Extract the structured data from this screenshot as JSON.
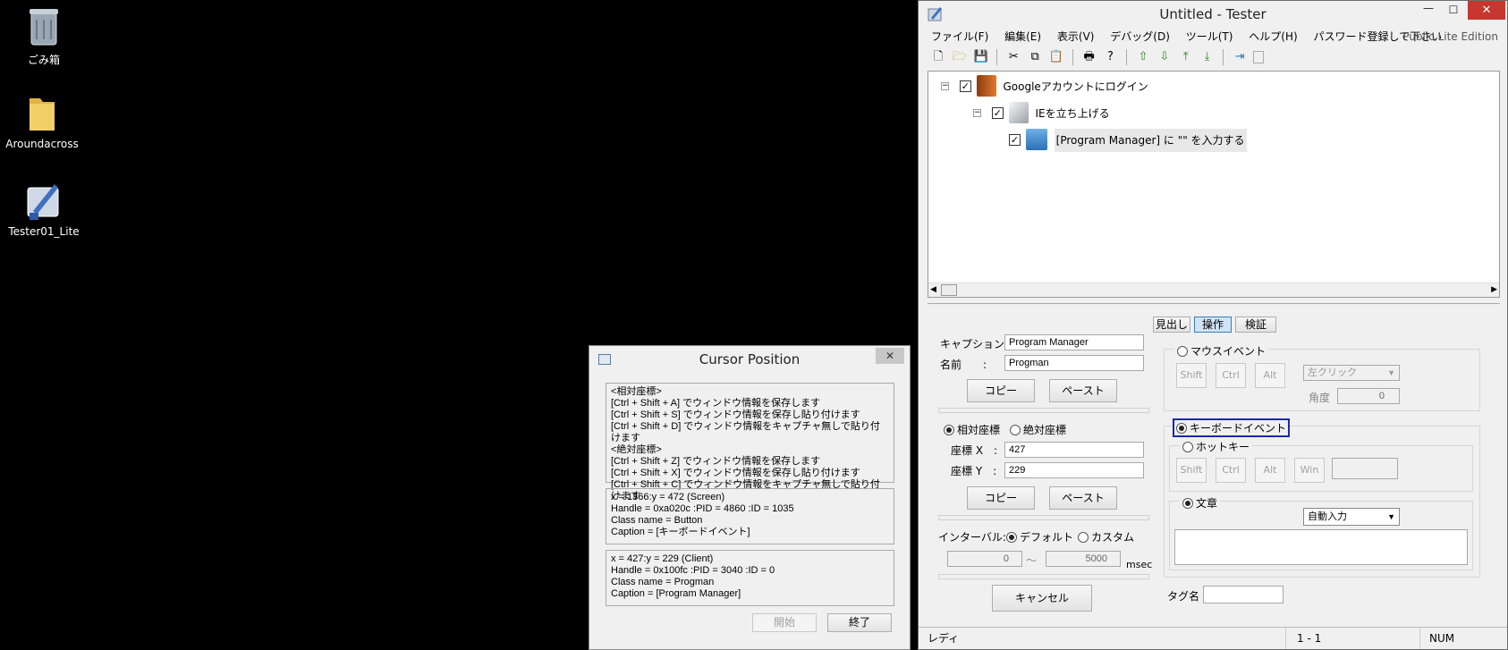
{
  "desktop": {
    "icons": [
      {
        "label": "ごみ箱"
      },
      {
        "label": "Aroundacross"
      },
      {
        "label": "Tester01_Lite"
      }
    ]
  },
  "cursor_window": {
    "title": "Cursor Position",
    "close_glyph": "✕",
    "info_lines": [
      "<相対座標>",
      "[Ctrl + Shift + A] でウィンドウ情報を保存します",
      "[Ctrl + Shift + S] でウィンドウ情報を保存し貼り付けます",
      "[Ctrl + Shift + D] でウィンドウ情報をキャプチャ無しで貼り付けます",
      "<絶対座標>",
      "[Ctrl + Shift + Z] でウィンドウ情報を保存します",
      "[Ctrl + Shift + X] でウィンドウ情報を保存し貼り付けます",
      "[Ctrl + Shift + C] でウィンドウ情報をキャプチャ無しで貼り付けます"
    ],
    "screen_lines": [
      "x = 1366:y =  472  (Screen)",
      "Handle = 0xa020c  :PID = 4860   :ID = 1035",
      "Class name = Button",
      "Caption = [キーボードイベント]"
    ],
    "client_lines": [
      "x =  427:y =  229   (Client)",
      "Handle = 0x100fc  :PID = 3040   :ID = 0",
      "Class name = Progman",
      "Caption = [Program Manager]"
    ],
    "start_label": "開始",
    "end_label": "終了"
  },
  "tester": {
    "title": "Untitled - Tester",
    "win_buttons": {
      "min": "—",
      "max": "☐",
      "close": "✕"
    },
    "menu": [
      "ファイル(F)",
      "編集(E)",
      "表示(V)",
      "デバッグ(D)",
      "ツール(T)",
      "ヘルプ(H)",
      "パスワード登録して下さい"
    ],
    "edition": "Public Lite Edition",
    "toolbar_icons": [
      "new-icon",
      "open-icon",
      "save-icon",
      "cut-icon",
      "copy-icon",
      "paste-icon",
      "print-icon",
      "help-icon",
      "move-up-icon",
      "move-down-icon",
      "move-top-icon",
      "move-bottom-icon",
      "export-icon",
      "blank-icon"
    ],
    "tree": [
      {
        "label": "Googleアカウントにログイン",
        "level": 0
      },
      {
        "label": "IEを立ち上げる",
        "level": 1
      },
      {
        "label": "[Program Manager] に \"\" を入力する",
        "level": 2
      }
    ],
    "tabs": [
      "見出し",
      "操作",
      "検証"
    ],
    "active_tab": "操作",
    "caption_label": "キャプション:",
    "caption_value": "Program Manager",
    "name_label": "名前　　:",
    "name_value": "Progman",
    "copy_label": "コピー",
    "paste_label": "ペースト",
    "coord_modes": [
      "相対座標",
      "絶対座標"
    ],
    "x_label": "座標 X　:",
    "x_value": "427",
    "y_label": "座標 Y　:",
    "y_value": "229",
    "interval_label": "インターバル:",
    "interval_options": [
      "デフォルト",
      "カスタム"
    ],
    "interval_min": "0",
    "interval_max": "5000",
    "interval_tilde": "～",
    "msec_label": "msec",
    "cancel_label": "キャンセル",
    "mouse_event_label": "マウスイベント",
    "shift_label": "Shift",
    "ctrl_label": "Ctrl",
    "alt_label": "Alt",
    "win_label": "Win",
    "click_select": "左クリック",
    "angle_label": "角度",
    "angle_value": "0",
    "keyboard_event_label": "キーボードイベント",
    "hotkey_label": "ホットキー",
    "text_label": "文章",
    "auto_input_select": "自動入力",
    "tag_label": "タグ名",
    "status": {
      "ready": "レディ",
      "position": "1 -   1",
      "num": "NUM"
    }
  }
}
